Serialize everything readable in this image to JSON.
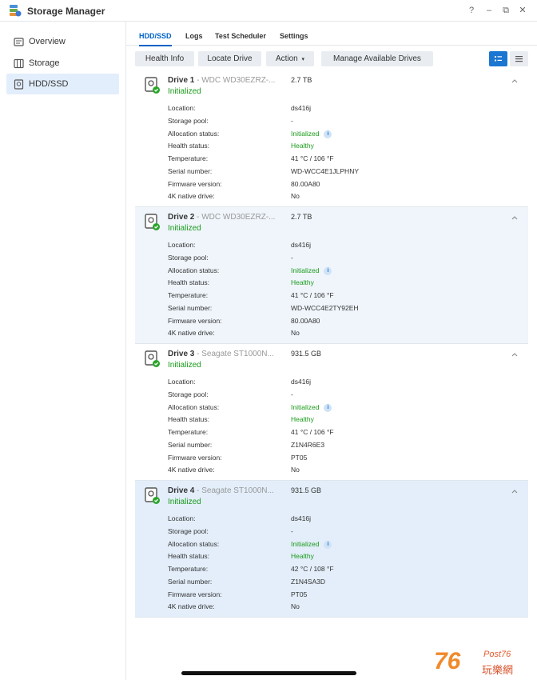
{
  "app": {
    "title": "Storage Manager"
  },
  "window_controls": {
    "help": "?",
    "minimize": "–",
    "restore": "⧉",
    "close": "✕"
  },
  "sidebar": {
    "items": [
      {
        "label": "Overview",
        "icon": "overview-icon"
      },
      {
        "label": "Storage",
        "icon": "storage-icon"
      },
      {
        "label": "HDD/SSD",
        "icon": "hdd-icon"
      }
    ]
  },
  "tabs": [
    "HDD/SSD",
    "Logs",
    "Test Scheduler",
    "Settings"
  ],
  "toolbar": {
    "health_info": "Health Info",
    "locate_drive": "Locate Drive",
    "action": "Action",
    "manage": "Manage Available Drives"
  },
  "labels": {
    "location": "Location:",
    "storage_pool": "Storage pool:",
    "allocation": "Allocation status:",
    "health": "Health status:",
    "temperature": "Temperature:",
    "serial": "Serial number:",
    "firmware": "Firmware version:",
    "native4k": "4K native drive:"
  },
  "drives": [
    {
      "name": "Drive 1",
      "model": " - WDC WD30EZRZ-...",
      "size": "2.7 TB",
      "status": "Initialized",
      "location": "ds416j",
      "storage_pool": "-",
      "allocation": "Initialized",
      "health": "Healthy",
      "temperature": "41 °C / 106 °F",
      "serial": "WD-WCC4E1JLPHNY",
      "firmware": "80.00A80",
      "native4k": "No"
    },
    {
      "name": "Drive 2",
      "model": " - WDC WD30EZRZ-...",
      "size": "2.7 TB",
      "status": "Initialized",
      "location": "ds416j",
      "storage_pool": "-",
      "allocation": "Initialized",
      "health": "Healthy",
      "temperature": "41 °C / 106 °F",
      "serial": "WD-WCC4E2TY92EH",
      "firmware": "80.00A80",
      "native4k": "No"
    },
    {
      "name": "Drive 3",
      "model": " - Seagate ST1000N...",
      "size": "931.5 GB",
      "status": "Initialized",
      "location": "ds416j",
      "storage_pool": "-",
      "allocation": "Initialized",
      "health": "Healthy",
      "temperature": "41 °C / 106 °F",
      "serial": "Z1N4R6E3",
      "firmware": "PT05",
      "native4k": "No"
    },
    {
      "name": "Drive 4",
      "model": " - Seagate ST1000N...",
      "size": "931.5 GB",
      "status": "Initialized",
      "location": "ds416j",
      "storage_pool": "-",
      "allocation": "Initialized",
      "health": "Healthy",
      "temperature": "42 °C / 108 °F",
      "serial": "Z1N4SA3D",
      "firmware": "PT05",
      "native4k": "No"
    }
  ],
  "watermark": {
    "num": "76",
    "brand": "Post76",
    "cn": "玩樂網"
  },
  "colors": {
    "accent": "#0063c6",
    "healthy": "#1a9b1a",
    "selected_row": "#e3eefa"
  }
}
